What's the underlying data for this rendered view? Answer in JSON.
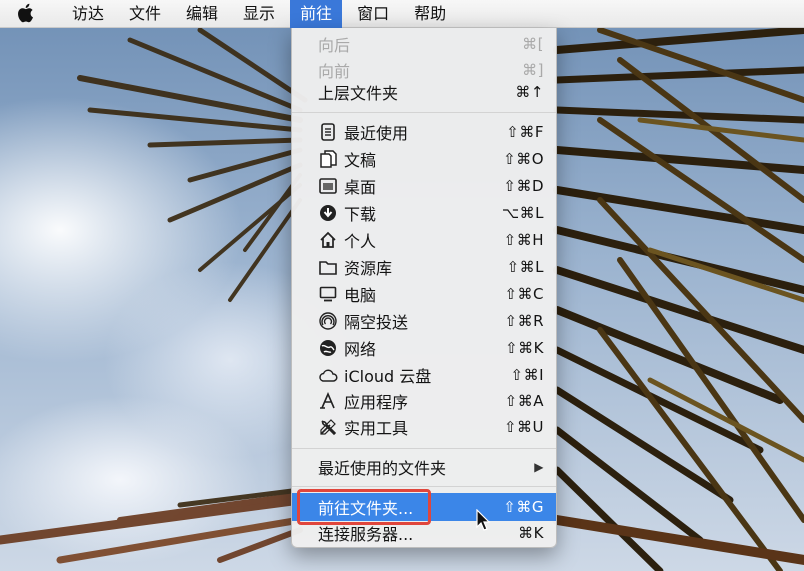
{
  "menubar": {
    "apple_icon": "apple-logo-icon",
    "items": [
      {
        "label": "访达"
      },
      {
        "label": "文件"
      },
      {
        "label": "编辑"
      },
      {
        "label": "显示"
      },
      {
        "label": "前往",
        "active": true
      },
      {
        "label": "窗口"
      },
      {
        "label": "帮助"
      }
    ]
  },
  "go_menu": {
    "back": {
      "label": "向后",
      "shortcut": "⌘["
    },
    "forward": {
      "label": "向前",
      "shortcut": "⌘]"
    },
    "enclosing": {
      "label": "上层文件夹",
      "shortcut": "⌘↑"
    },
    "places": [
      {
        "label": "最近使用",
        "shortcut": "⇧⌘F",
        "icon": "recents-icon"
      },
      {
        "label": "文稿",
        "shortcut": "⇧⌘O",
        "icon": "documents-icon"
      },
      {
        "label": "桌面",
        "shortcut": "⇧⌘D",
        "icon": "desktop-icon"
      },
      {
        "label": "下载",
        "shortcut": "⌥⌘L",
        "icon": "downloads-icon"
      },
      {
        "label": "个人",
        "shortcut": "⇧⌘H",
        "icon": "home-icon"
      },
      {
        "label": "资源库",
        "shortcut": "⇧⌘L",
        "icon": "library-folder-icon"
      },
      {
        "label": "电脑",
        "shortcut": "⇧⌘C",
        "icon": "computer-icon"
      },
      {
        "label": "隔空投送",
        "shortcut": "⇧⌘R",
        "icon": "airdrop-icon"
      },
      {
        "label": "网络",
        "shortcut": "⇧⌘K",
        "icon": "network-icon"
      },
      {
        "label": "iCloud 云盘",
        "shortcut": "⇧⌘I",
        "icon": "icloud-icon"
      },
      {
        "label": "应用程序",
        "shortcut": "⇧⌘A",
        "icon": "applications-icon"
      },
      {
        "label": "实用工具",
        "shortcut": "⇧⌘U",
        "icon": "utilities-icon"
      }
    ],
    "recent_folders": {
      "label": "最近使用的文件夹",
      "submenu_icon": "submenu-arrow-icon"
    },
    "go_to_folder": {
      "label": "前往文件夹...",
      "shortcut": "⇧⌘G",
      "highlighted": true
    },
    "connect_server": {
      "label": "连接服务器...",
      "shortcut": "⌘K"
    }
  },
  "colors": {
    "menu_highlight": "#3b86e8",
    "annotation_box": "#e0463c",
    "menubar_active": "#3a78d9"
  }
}
